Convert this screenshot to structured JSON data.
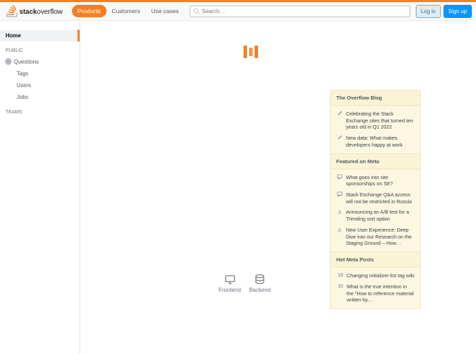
{
  "topbar": {
    "nav": {
      "products": "Products",
      "customers": "Customers",
      "usecases": "Use cases"
    },
    "search_placeholder": "Search…",
    "login": "Log in",
    "signup": "Sign up"
  },
  "leftnav": {
    "home": "Home",
    "public_label": "PUBLIC",
    "questions": "Questions",
    "tags": "Tags",
    "users": "Users",
    "jobs": "Jobs",
    "teams_label": "TEAMS"
  },
  "widget": {
    "heading_blog": "The Overflow Blog",
    "blog": [
      "Celebrating the Stack Exchange sites that turned ten years old in Q1 2022",
      "New data: What makes developers happy at work"
    ],
    "heading_meta": "Featured on Meta",
    "meta": [
      "What goes into site sponsorships on SE?",
      "Stack Exchange Q&amp;A access will not be restricted in Russia",
      "Announcing an A/B test for a Trending sort option",
      "New User Experience: Deep Dive into our Research on the Staging Ground – How…"
    ],
    "heading_hot": "Hot Meta Posts",
    "hot": [
      {
        "score": "16",
        "title": "Changing initializer-list tag wiki"
      },
      {
        "score": "10",
        "title": "What is the true intention in the \"How to reference material written by…"
      }
    ]
  },
  "tech": {
    "frontend": "Frontend",
    "backend": "Backend"
  }
}
